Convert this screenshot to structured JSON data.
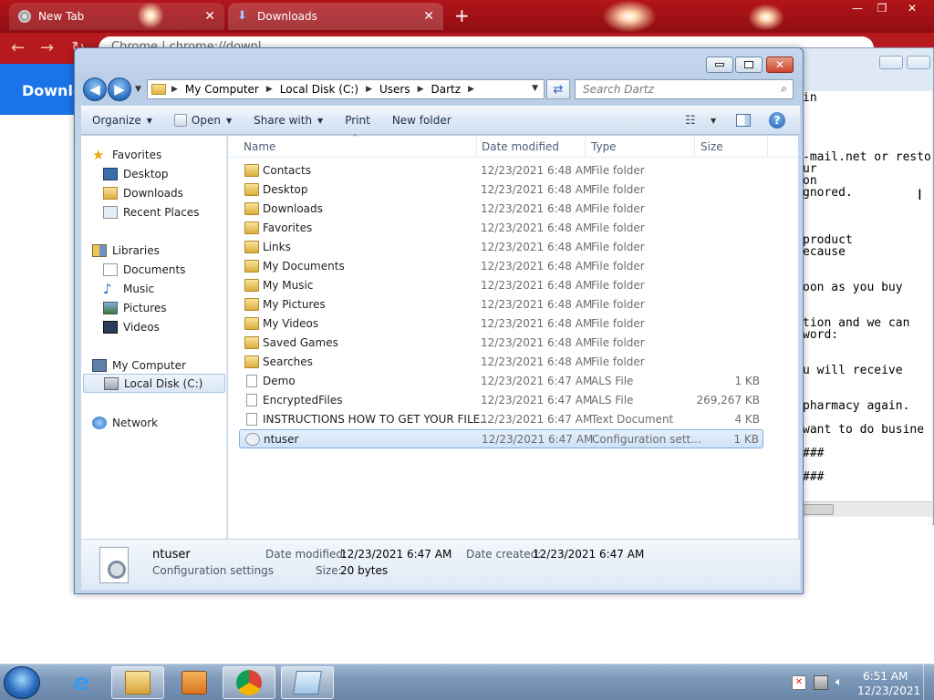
{
  "chrome": {
    "tabs": [
      {
        "label": "New Tab"
      },
      {
        "label": "Downloads"
      }
    ],
    "omnibox_text": "Chrome | chrome://downl...",
    "page_title": "Downloa"
  },
  "notepad": {
    "lines": [
      "in",
      "-mail.net or resto",
      "ur",
      "on",
      "gnored.",
      "product",
      "ecause",
      "oon as you buy",
      "tion and we can",
      "word:",
      "u will receive",
      "pharmacy again.",
      "want to do busine",
      "###",
      "###"
    ]
  },
  "explorer": {
    "breadcrumb": [
      "My Computer",
      "Local Disk (C:)",
      "Users",
      "Dartz"
    ],
    "search_placeholder": "Search Dartz",
    "commands": [
      {
        "label": "Organize",
        "has_dropdown": true
      },
      {
        "label": "Open",
        "has_dropdown": true
      },
      {
        "label": "Share with",
        "has_dropdown": true
      },
      {
        "label": "Print",
        "has_dropdown": false
      },
      {
        "label": "New folder",
        "has_dropdown": false
      }
    ],
    "nav_pane": {
      "favorites_label": "Favorites",
      "favorites": [
        "Desktop",
        "Downloads",
        "Recent Places"
      ],
      "libraries_label": "Libraries",
      "libraries": [
        "Documents",
        "Music",
        "Pictures",
        "Videos"
      ],
      "computer_label": "My Computer",
      "computer_items": [
        "Local Disk (C:)"
      ],
      "network_label": "Network",
      "selected": "Local Disk (C:)"
    },
    "columns": {
      "name": "Name",
      "date": "Date modified",
      "type": "Type",
      "size": "Size"
    },
    "files": [
      {
        "name": "Contacts",
        "date": "12/23/2021 6:48 AM",
        "type": "File folder",
        "size": "",
        "icon": "folder-icon"
      },
      {
        "name": "Desktop",
        "date": "12/23/2021 6:48 AM",
        "type": "File folder",
        "size": "",
        "icon": "folder-icon"
      },
      {
        "name": "Downloads",
        "date": "12/23/2021 6:48 AM",
        "type": "File folder",
        "size": "",
        "icon": "folder-icon"
      },
      {
        "name": "Favorites",
        "date": "12/23/2021 6:48 AM",
        "type": "File folder",
        "size": "",
        "icon": "folder-icon"
      },
      {
        "name": "Links",
        "date": "12/23/2021 6:48 AM",
        "type": "File folder",
        "size": "",
        "icon": "folder-icon"
      },
      {
        "name": "My Documents",
        "date": "12/23/2021 6:48 AM",
        "type": "File folder",
        "size": "",
        "icon": "folder-icon"
      },
      {
        "name": "My Music",
        "date": "12/23/2021 6:48 AM",
        "type": "File folder",
        "size": "",
        "icon": "folder-icon"
      },
      {
        "name": "My Pictures",
        "date": "12/23/2021 6:48 AM",
        "type": "File folder",
        "size": "",
        "icon": "folder-icon"
      },
      {
        "name": "My Videos",
        "date": "12/23/2021 6:48 AM",
        "type": "File folder",
        "size": "",
        "icon": "folder-icon"
      },
      {
        "name": "Saved Games",
        "date": "12/23/2021 6:48 AM",
        "type": "File folder",
        "size": "",
        "icon": "folder-icon"
      },
      {
        "name": "Searches",
        "date": "12/23/2021 6:48 AM",
        "type": "File folder",
        "size": "",
        "icon": "folder-icon"
      },
      {
        "name": "Demo",
        "date": "12/23/2021 6:47 AM",
        "type": "ALS File",
        "size": "1 KB",
        "icon": "file-icon"
      },
      {
        "name": "EncryptedFiles",
        "date": "12/23/2021 6:47 AM",
        "type": "ALS File",
        "size": "269,267 KB",
        "icon": "file-icon"
      },
      {
        "name": "INSTRUCTIONS HOW TO GET YOUR FILE...",
        "date": "12/23/2021 6:47 AM",
        "type": "Text Document",
        "size": "4 KB",
        "icon": "text-file-icon"
      },
      {
        "name": "ntuser",
        "date": "12/23/2021 6:47 AM",
        "type": "Configuration sett...",
        "size": "1 KB",
        "icon": "config-file-icon",
        "selected": true
      }
    ],
    "details": {
      "name": "ntuser",
      "type": "Configuration settings",
      "modified_label": "Date modified:",
      "modified_value": "12/23/2021 6:47 AM",
      "created_label": "Date created:",
      "created_value": "12/23/2021 6:47 AM",
      "size_label": "Size:",
      "size_value": "20 bytes"
    }
  },
  "taskbar": {
    "items": [
      "internet-explorer-icon",
      "windows-explorer-icon",
      "media-player-icon",
      "chrome-icon",
      "notepad-icon"
    ],
    "clock_time": "6:51 AM",
    "clock_date": "12/23/2021"
  },
  "colors": {
    "chrome_red": "#b3151a",
    "selection_blue": "#cfe2f7",
    "win7_frame": "#b9cde6",
    "chrome_blue": "#1a73e8"
  }
}
